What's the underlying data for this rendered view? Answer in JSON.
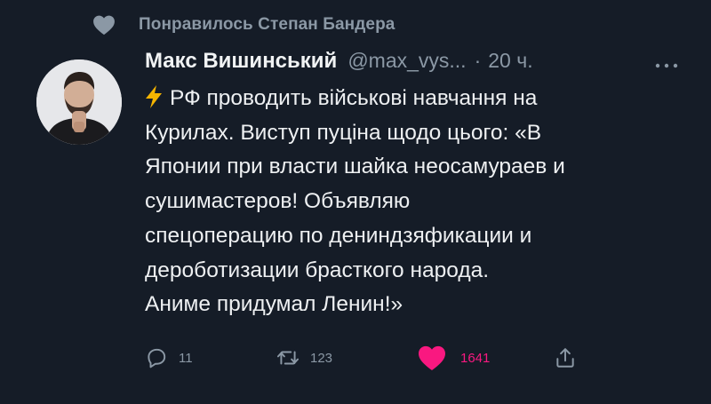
{
  "social_context": {
    "text": "Понравилось Степан Бандера",
    "icon": "heart-icon"
  },
  "author": {
    "name": "Макс Вишинський",
    "handle": "@max_vys...",
    "separator": "·",
    "time": "20 ч."
  },
  "tweet": {
    "lines": [
      "РФ проводить військові навчання на",
      "Курилах. Виступ пуціна щодо цього: «В",
      "Японии при власти шайка неосамураев и",
      "сушимастеров! Объявляю",
      "спецоперацию по дениндзяфикации и",
      "дероботизации брасткого народа.",
      "Аниме придумал Ленин!»"
    ],
    "lead_icon": "lightning-bolt-icon"
  },
  "actions": {
    "reply_count": "11",
    "retweet_count": "123",
    "like_count": "1641",
    "liked": true
  },
  "colors": {
    "background": "#151c27",
    "muted": "#8b98a5",
    "like": "#f91880",
    "bolt": "#f5b400"
  }
}
